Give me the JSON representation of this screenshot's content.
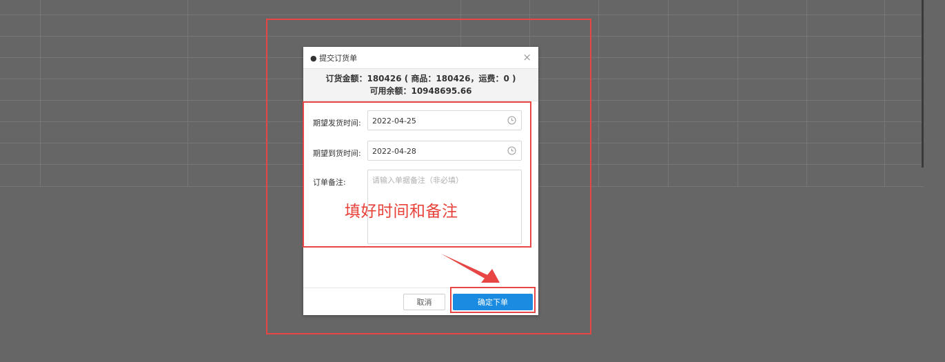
{
  "dialog": {
    "title": "● 提交订货单",
    "close_glyph": "×",
    "summary_line1": "订货金额：180426 ( 商品：180426，运费：0 )",
    "summary_line2": "可用余额：10948695.66"
  },
  "form": {
    "ship_time": {
      "label": "期望发货时间:",
      "value": "2022-04-25"
    },
    "arrive_time": {
      "label": "期望到货时间:",
      "value": "2022-04-28"
    },
    "remark": {
      "label": "订单备注:",
      "placeholder": "请输入单据备注（非必填）",
      "value": ""
    }
  },
  "footer": {
    "cancel_label": "取消",
    "confirm_label": "确定下单"
  },
  "annotation": {
    "text": "填好时间和备注",
    "color": "#e8413a"
  },
  "colors": {
    "primary": "#1a8be0",
    "overlay": "#666666",
    "annotation": "#e84545"
  }
}
